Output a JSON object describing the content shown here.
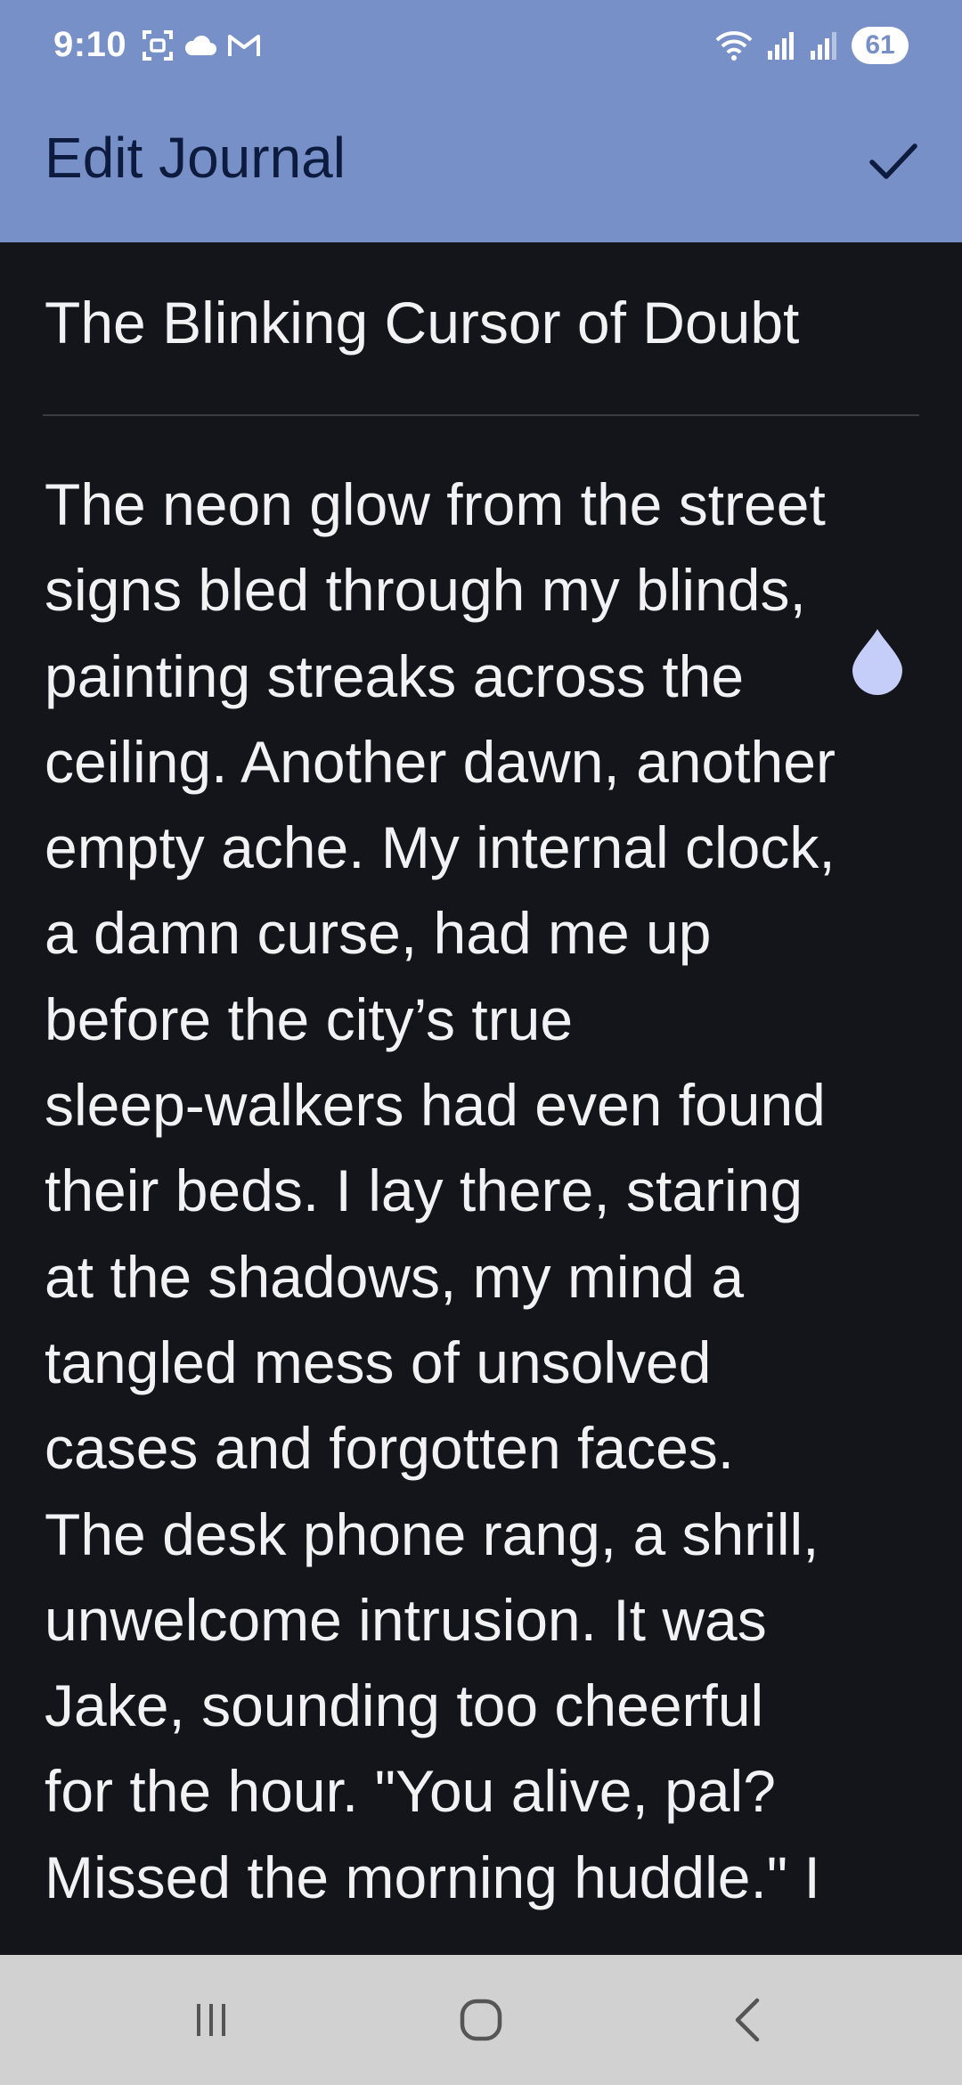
{
  "status_bar": {
    "time": "9:10",
    "battery": "61",
    "icons": [
      "screenshot-icon",
      "cloud-icon",
      "gmail-icon",
      "wifi-icon",
      "signal-icon",
      "signal-icon-2",
      "battery-icon"
    ]
  },
  "app_bar": {
    "title": "Edit Journal",
    "confirm_icon": "check-icon"
  },
  "editor": {
    "title": "The Blinking Cursor of Doubt",
    "body_lines": [
      "The neon glow from the street",
      "signs bled through my blinds,",
      "painting streaks across the",
      "ceiling. Another dawn, another",
      "empty ache. My internal clock,",
      "a damn curse, had me up",
      "before the city’s true",
      "sleep-walkers had even found",
      "their beds. I lay there, staring",
      "at the shadows, my mind a",
      "tangled mess of unsolved",
      "cases and forgotten faces.",
      "The desk phone rang, a shrill,",
      "unwelcome intrusion. It was",
      "Jake, sounding too cheerful",
      "for the hour. \"You alive, pal?",
      "Missed the morning huddle.\" I"
    ]
  },
  "nav_bar": {
    "buttons": [
      "recents-icon",
      "home-icon",
      "back-icon"
    ]
  },
  "colors": {
    "app_bar": "#7890c8",
    "background": "#14151b",
    "text": "#f2f2f4",
    "title_text": "#0d1b3e",
    "cursor_handle": "#c4cef8",
    "nav_bar": "#d1d1d1"
  }
}
